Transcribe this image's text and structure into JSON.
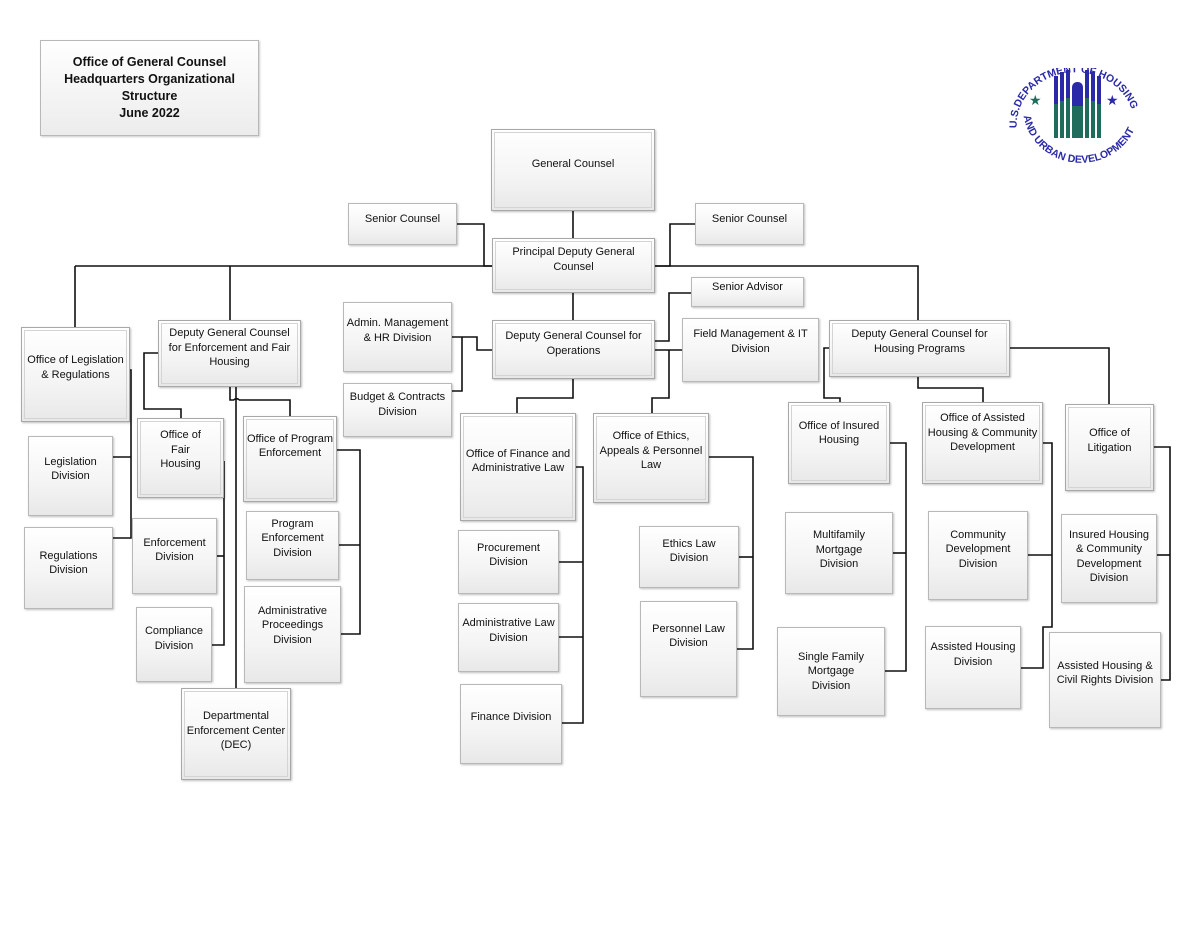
{
  "title": {
    "line1": "Office of General Counsel",
    "line2": "Headquarters Organizational",
    "line3": "Structure",
    "line4": "June 2022"
  },
  "logo": {
    "top_text": "U.S.DEPARTMENT OF HOUSING",
    "bottom_text": "AND URBAN DEVELOPMENT",
    "colors": {
      "blue": "#2a2aa8",
      "green": "#1f6b5c"
    }
  },
  "nodes": {
    "general_counsel": "General Counsel",
    "senior_counsel_left": "Senior Counsel",
    "senior_counsel_right": "Senior Counsel",
    "principal_deputy": "Principal Deputy General Counsel",
    "office_legislation": "Office of Legislation & Regulations",
    "legislation_division": "Legislation Division",
    "regulations_division": "Regulations Division",
    "dgc_enforcement": "Deputy General Counsel for Enforcement and Fair Housing",
    "office_fair_housing": "Office of Fair Housing",
    "enforcement_division": "Enforcement Division",
    "compliance_division": "Compliance Division",
    "office_program_enforcement": "Office of Program Enforcement",
    "program_enforcement_division": "Program Enforcement Division",
    "administrative_proceedings_division": "Administrative Proceedings Division",
    "dec": "Departmental Enforcement Center (DEC)",
    "admin_mgmt_hr": "Admin. Management & HR Division",
    "budget_contracts": "Budget & Contracts Division",
    "dgc_operations": "Deputy General Counsel for Operations",
    "senior_advisor": "Senior Advisor",
    "field_mgmt_it": "Field Management & IT Division",
    "office_finance_admin_law": "Office of Finance and Administrative Law",
    "procurement_division": "Procurement Division",
    "administrative_law_division": "Administrative Law Division",
    "finance_division": "Finance  Division",
    "office_ethics": "Office of Ethics, Appeals & Personnel Law",
    "ethics_law_division": "Ethics Law Division",
    "personnel_law_division": "Personnel Law Division",
    "dgc_housing": "Deputy General Counsel for Housing Programs",
    "office_insured_housing": "Office of Insured Housing",
    "multifamily_mortgage": "Multifamily Mortgage Division",
    "single_family_mortgage": "Single Family Mortgage Division",
    "office_assisted_housing": "Office of Assisted Housing & Community Development",
    "community_development_division": "Community Development Division",
    "assisted_housing_division": "Assisted Housing Division",
    "office_litigation": "Office of Litigation",
    "insured_housing_cd_division": "Insured Housing & Community Development Division",
    "assisted_housing_civil_rights": "Assisted Housing & Civil Rights Division"
  }
}
